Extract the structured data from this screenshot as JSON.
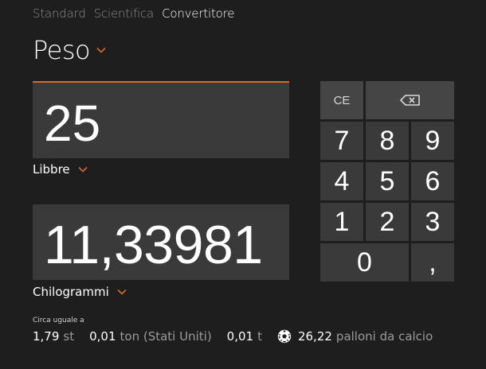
{
  "tabs": [
    {
      "label": "Standard",
      "active": false
    },
    {
      "label": "Scientifica",
      "active": false
    },
    {
      "label": "Convertitore",
      "active": true
    }
  ],
  "category": {
    "label": "Peso"
  },
  "input": {
    "value": "25",
    "unit": "Libbre"
  },
  "output": {
    "value": "11,33981",
    "unit": "Chilogrammi"
  },
  "keypad": {
    "ce": "CE",
    "backspace_icon": "backspace-icon",
    "k7": "7",
    "k8": "8",
    "k9": "9",
    "k4": "4",
    "k5": "5",
    "k6": "6",
    "k1": "1",
    "k2": "2",
    "k3": "3",
    "k0": "0",
    "decimal": ","
  },
  "approx": {
    "caption": "Circa uguale a",
    "items": [
      {
        "value": "1,79",
        "unit": "st"
      },
      {
        "value": "0,01",
        "unit": "ton (Stati Uniti)"
      },
      {
        "value": "0,01",
        "unit": "t"
      },
      {
        "value": "26,22",
        "unit": "palloni da calcio",
        "icon": "soccer-ball-icon"
      }
    ]
  },
  "colors": {
    "accent": "#d9692a",
    "background": "#1e1e1e",
    "box": "#3a3a3a",
    "muted_text": "#9a9a9a"
  }
}
